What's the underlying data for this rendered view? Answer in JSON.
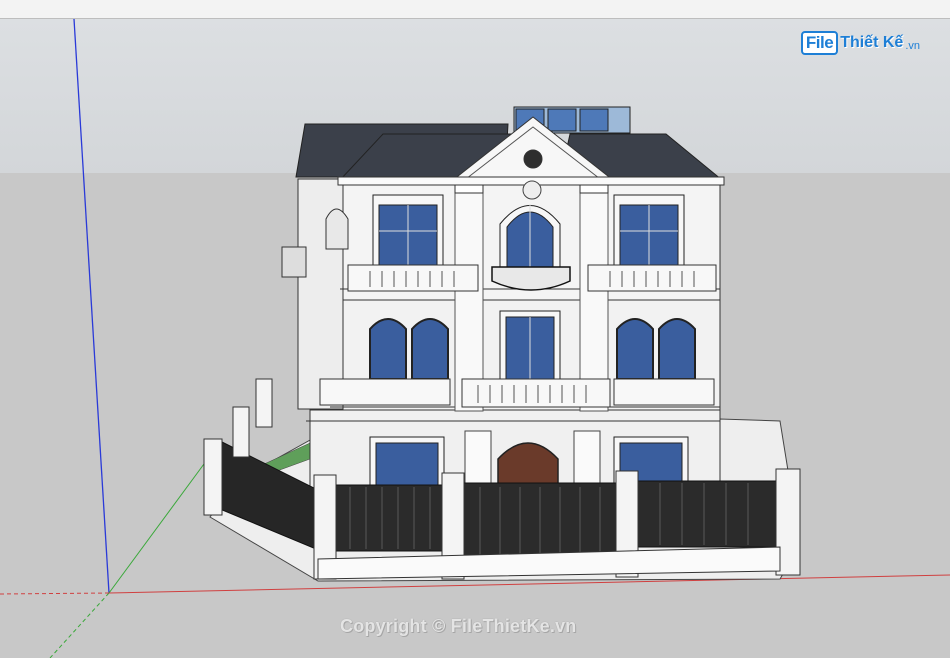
{
  "logo": {
    "file": "File",
    "brand": "Thiết Kế",
    "tld": ".vn"
  },
  "watermark": {
    "text": "Copyright © FileThietKe.vn"
  },
  "colors": {
    "axis_blue": "#2a3ad8",
    "axis_red": "#d04040",
    "axis_green": "#3aa83a",
    "roof": "#3b404a",
    "glass": "#3a5e9e",
    "fence": "#262626"
  }
}
